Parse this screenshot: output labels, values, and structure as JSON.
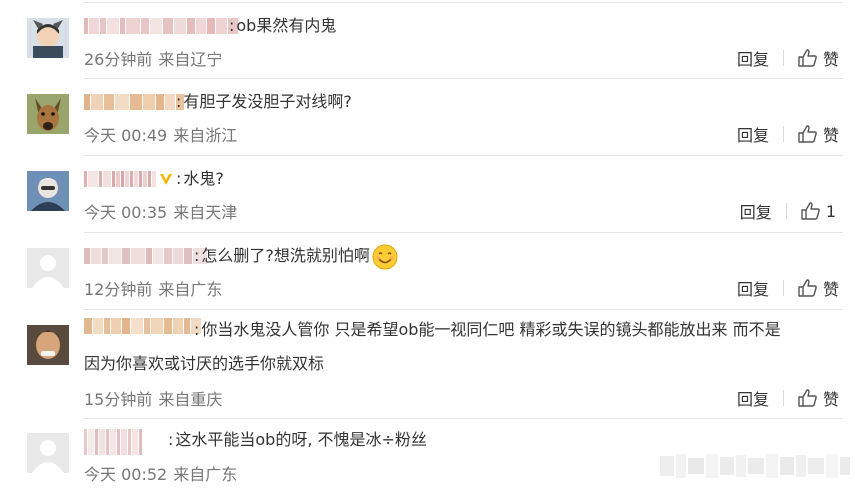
{
  "comments": [
    {
      "text": "ob果然有内鬼",
      "time": "26分钟前",
      "location": "来自辽宁",
      "reply": "回复",
      "like": "赞"
    },
    {
      "text": "有胆子发没胆子对线啊?",
      "time": "今天 00:49",
      "location": "来自浙江",
      "reply": "回复",
      "like": "赞"
    },
    {
      "text": "水鬼?",
      "time": "今天 00:35",
      "location": "来自天津",
      "reply": "回复",
      "like": "1"
    },
    {
      "text": "怎么删了?想洗就别怕啊",
      "time": "12分钟前",
      "location": "来自广东",
      "reply": "回复",
      "like": "赞"
    },
    {
      "text_line1": "你当水鬼没人管你 只是希望ob能一视同仁吧 精彩或失误的镜头都能放出来 而不是",
      "text_line2": "因为你喜欢或讨厌的选手你就双标",
      "time": "15分钟前",
      "location": "来自重庆",
      "reply": "回复",
      "like": "赞"
    },
    {
      "text": "这水平能当ob的呀, 不愧是冰÷粉丝",
      "time": "今天 00:52",
      "location": "来自广东"
    }
  ],
  "colon": ":",
  "icons": {
    "like": "thumbs-up-icon",
    "verified": "verified-v-icon",
    "emoji": "smile-emoji-icon"
  },
  "colors": {
    "meta": "#777777",
    "text": "#333333",
    "divider": "#e6e6e6",
    "badge": "#f7b500"
  }
}
